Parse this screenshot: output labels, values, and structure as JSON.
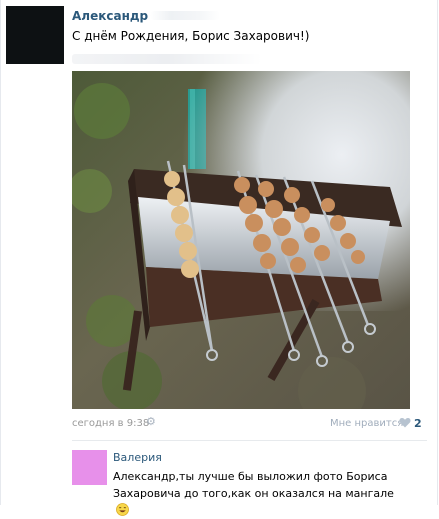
{
  "post": {
    "author": "Александр",
    "text": "С днём Рождения, Борис Захарович!)",
    "time": "сегодня в 9:38",
    "like_label": "Мне нравится",
    "like_count": "2",
    "icons": {
      "settings": "gear-icon",
      "like": "heart-icon"
    }
  },
  "comment": {
    "author": "Валерия",
    "text": "Александр,ты лучше бы выложил фото Бориса Захаровича до того,как он оказался на мангале",
    "emoji": "smile-icon"
  },
  "colors": {
    "link": "#2b587a",
    "meta": "#999999",
    "comment_avatar": "#e790ea",
    "post_avatar": "#0d1113"
  }
}
